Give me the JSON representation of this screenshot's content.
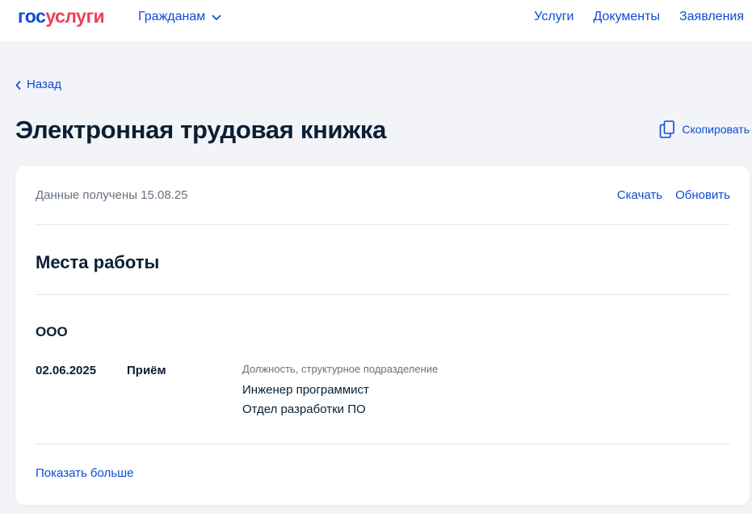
{
  "header": {
    "logo_part1": "гос",
    "logo_part2": "услуги",
    "audience_label": "Гражданам",
    "nav": [
      "Услуги",
      "Документы",
      "Заявления"
    ]
  },
  "back_label": "Назад",
  "page_title": "Электронная трудовая книжка",
  "copy_label": "Скопировать",
  "card": {
    "received_text": "Данные получены 15.08.25",
    "download_label": "Скачать",
    "refresh_label": "Обновить",
    "section_title": "Места работы",
    "employer": "ООО",
    "record": {
      "date": "02.06.2025",
      "type": "Приём",
      "label": "Должность, структурное подразделение",
      "position": "Инженер программист",
      "department": "Отдел разработки ПО"
    },
    "show_more_label": "Показать больше"
  },
  "colors": {
    "link": "#0d4cd3",
    "logo_accent": "#ee3f58",
    "text": "#0b1f33",
    "muted": "#66727f",
    "page_bg": "#f2f4f8"
  },
  "icons": {
    "audience_chevron": "chevron-down-icon",
    "back": "chevron-left-icon",
    "copy": "copy-icon"
  }
}
